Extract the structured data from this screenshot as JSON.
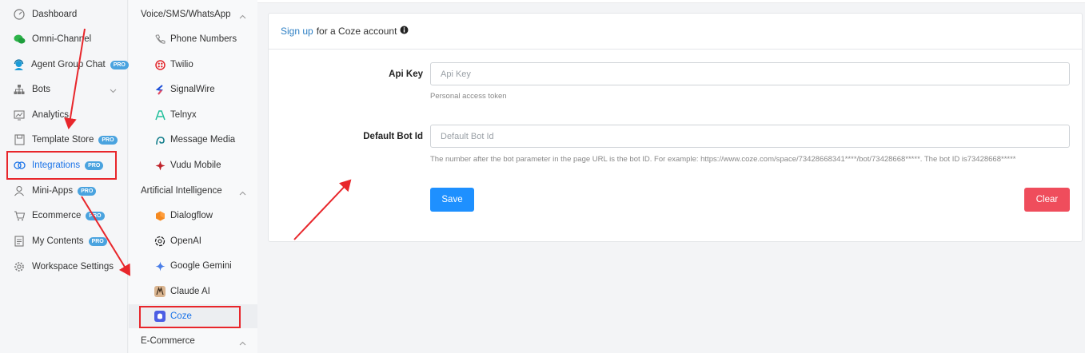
{
  "sidebar": {
    "items": [
      {
        "label": "Dashboard",
        "icon": "dashboard-icon"
      },
      {
        "label": "Omni-Channel",
        "icon": "chat-bubbles-icon"
      },
      {
        "label": "Agent Group Chat",
        "icon": "agent-headset-icon",
        "badge": "PRO"
      },
      {
        "label": "Bots",
        "icon": "bots-hierarchy-icon"
      },
      {
        "label": "Analytics",
        "icon": "analytics-icon"
      },
      {
        "label": "Template Store",
        "icon": "template-store-icon",
        "badge": "PRO"
      },
      {
        "label": "Integrations",
        "icon": "integrations-icon",
        "badge": "PRO"
      },
      {
        "label": "Mini-Apps",
        "icon": "mini-apps-icon",
        "badge": "PRO"
      },
      {
        "label": "Ecommerce",
        "icon": "cart-icon",
        "badge": "PRO"
      },
      {
        "label": "My Contents",
        "icon": "contents-icon",
        "badge": "PRO"
      },
      {
        "label": "Workspace Settings",
        "icon": "gear-icon"
      }
    ]
  },
  "subnav": {
    "sections": [
      {
        "title": "Voice/SMS/WhatsApp",
        "items": [
          "Phone Numbers",
          "Twilio",
          "SignalWire",
          "Telnyx",
          "Message Media",
          "Vudu Mobile"
        ]
      },
      {
        "title": "Artificial Intelligence",
        "items": [
          "Dialogflow",
          "OpenAI",
          "Google Gemini",
          "Claude AI",
          "Coze"
        ]
      },
      {
        "title": "E-Commerce",
        "items": []
      }
    ]
  },
  "form": {
    "signup_link": "Sign up",
    "signup_rest": "for a Coze account",
    "api_key_label": "Api Key",
    "api_key_placeholder": "Api Key",
    "api_key_hint": "Personal access token",
    "bot_id_label": "Default Bot Id",
    "bot_id_placeholder": "Default Bot Id",
    "bot_id_hint": "The number after the bot parameter in the page URL is the bot ID. For example: https://www.coze.com/space/73428668341****/bot/73428668*****. The bot ID is73428668*****",
    "save_label": "Save",
    "clear_label": "Clear"
  },
  "colors": {
    "accent": "#1a73e8",
    "save": "#1e90ff",
    "clear": "#ef4d5c",
    "annotation": "#e8262b",
    "pro_badge": "#4aa3df"
  }
}
